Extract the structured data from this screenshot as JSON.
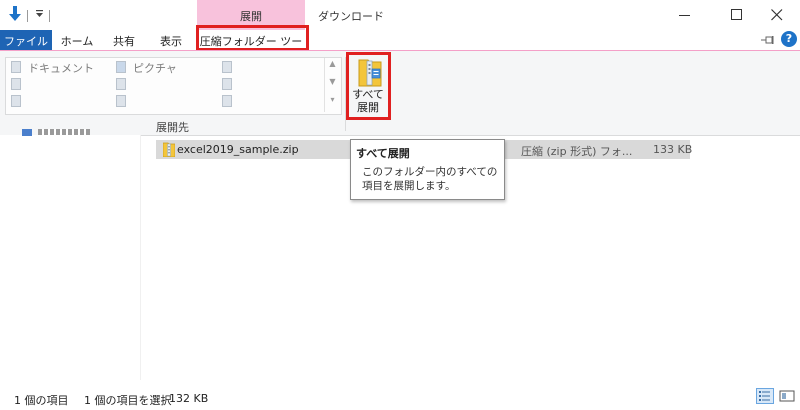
{
  "titlebar": {
    "context_tab_header": "展開",
    "window_title": "ダウンロード"
  },
  "tabs": {
    "file": "ファイル",
    "home": "ホーム",
    "share": "共有",
    "view": "表示",
    "compressed_tools": "圧縮フォルダー ツール"
  },
  "ribbon": {
    "destinations": [
      {
        "label": "ドキュメント",
        "icon": "document-icon"
      },
      {
        "label": "ピクチャ",
        "icon": "pictures-icon"
      }
    ],
    "group_label": "展開先",
    "extract_all_label_line1": "すべて",
    "extract_all_label_line2": "展開"
  },
  "file": {
    "name": "excel2019_sample.zip",
    "type": "圧縮 (zip 形式) フォ...",
    "size": "133 KB"
  },
  "tooltip": {
    "title": "すべて展開",
    "body": "このフォルダー内のすべての項目を展開します。"
  },
  "status": {
    "count": "1 個の項目",
    "selected": "1 個の項目を選択",
    "size": "132 KB"
  },
  "colors": {
    "context_tab": "#f8c2dc",
    "file_tab": "#1e64b4",
    "highlight_box": "#e02020",
    "selected_row": "#d9d9d9"
  }
}
